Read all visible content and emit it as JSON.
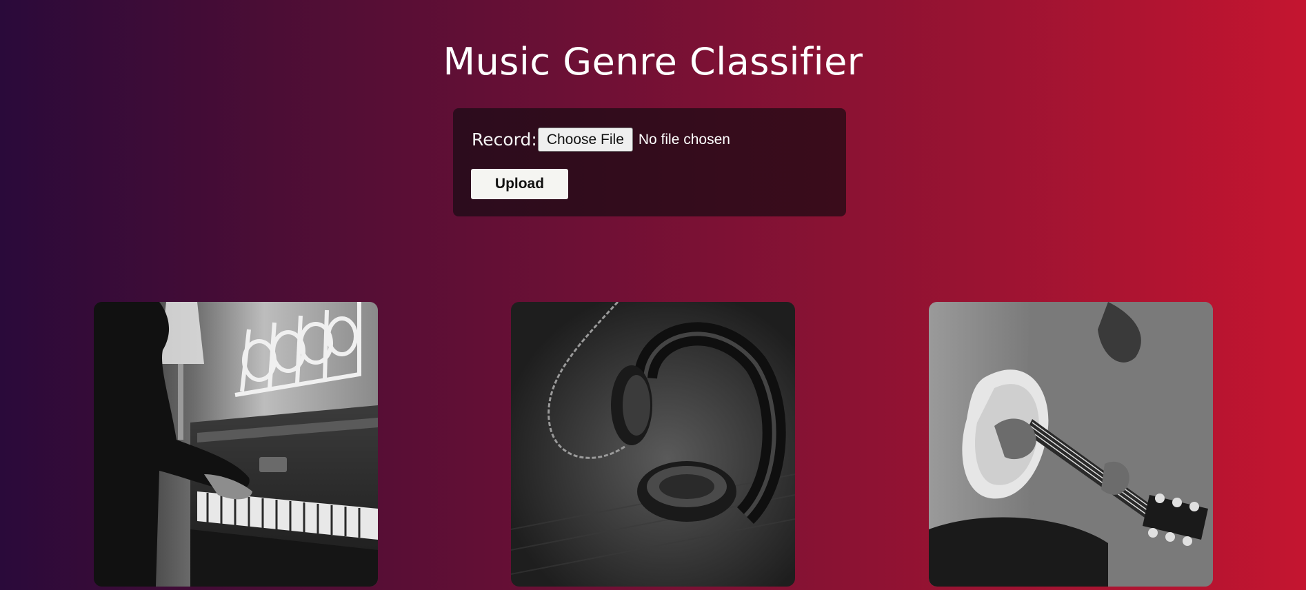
{
  "header": {
    "title": "Music Genre Classifier"
  },
  "upload_form": {
    "record_label": "Record:",
    "choose_file_label": "Choose File",
    "file_status": "No file chosen",
    "upload_label": "Upload"
  },
  "gallery": {
    "items": [
      {
        "subject": "piano"
      },
      {
        "subject": "headphones"
      },
      {
        "subject": "guitar"
      }
    ]
  },
  "colors": {
    "background_start": "#2a0a3a",
    "background_end": "#c41530",
    "card_background": "#3a0c1b",
    "button_background": "#f5f5f2"
  }
}
